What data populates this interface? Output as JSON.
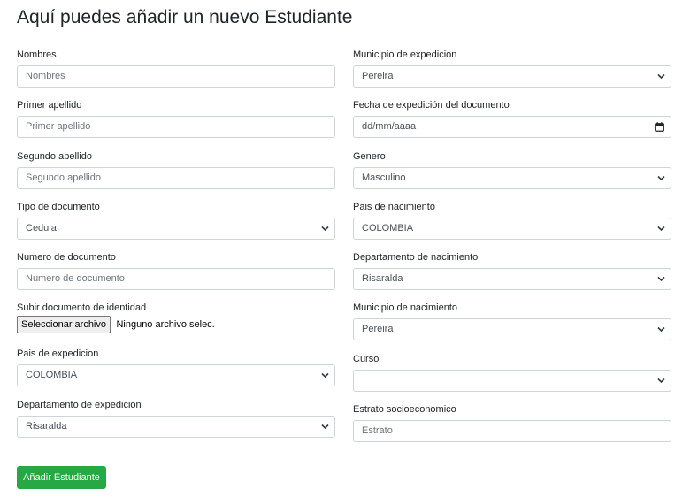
{
  "page": {
    "title": "Aquí puedes añadir un nuevo Estudiante"
  },
  "left": {
    "nombres": {
      "label": "Nombres",
      "placeholder": "Nombres"
    },
    "primer_apellido": {
      "label": "Primer apellido",
      "placeholder": "Primer apellido"
    },
    "segundo_apellido": {
      "label": "Segundo apellido",
      "placeholder": "Segundo apellido"
    },
    "tipo_documento": {
      "label": "Tipo de documento",
      "value": "Cedula"
    },
    "numero_documento": {
      "label": "Numero de documento",
      "placeholder": "Numero de documento"
    },
    "subir_documento": {
      "label": "Subir documento de identidad",
      "button_label": "Seleccionar archivo",
      "status": "Ninguno archivo selec."
    },
    "pais_expedicion": {
      "label": "Pais de expedicion",
      "value": "COLOMBIA"
    },
    "departamento_expedicion": {
      "label": "Departamento de expedicion",
      "value": "Risaralda"
    }
  },
  "right": {
    "municipio_expedicion": {
      "label": "Municipio de expedicion",
      "value": "Pereira"
    },
    "fecha_expedicion": {
      "label": "Fecha de expedición del documento",
      "value": "dd/mm/aaaa"
    },
    "genero": {
      "label": "Genero",
      "value": "Masculino"
    },
    "pais_nacimiento": {
      "label": "Pais de nacimiento",
      "value": "COLOMBIA"
    },
    "departamento_nacimiento": {
      "label": "Departamento de nacimiento",
      "value": "Risaralda"
    },
    "municipio_nacimiento": {
      "label": "Municipio de nacimiento",
      "value": "Pereira"
    },
    "curso": {
      "label": "Curso",
      "value": ""
    },
    "estrato": {
      "label": "Estrato socioeconomico",
      "placeholder": "Estrato"
    }
  },
  "actions": {
    "submit_label": "Añadir Estudiante"
  },
  "icons": {
    "select": "chevron-down-icon",
    "date": "calendar-icon"
  },
  "colors": {
    "primary_button": "#28a745",
    "border": "#ced4da",
    "text": "#212529",
    "placeholder": "#6c757d"
  }
}
